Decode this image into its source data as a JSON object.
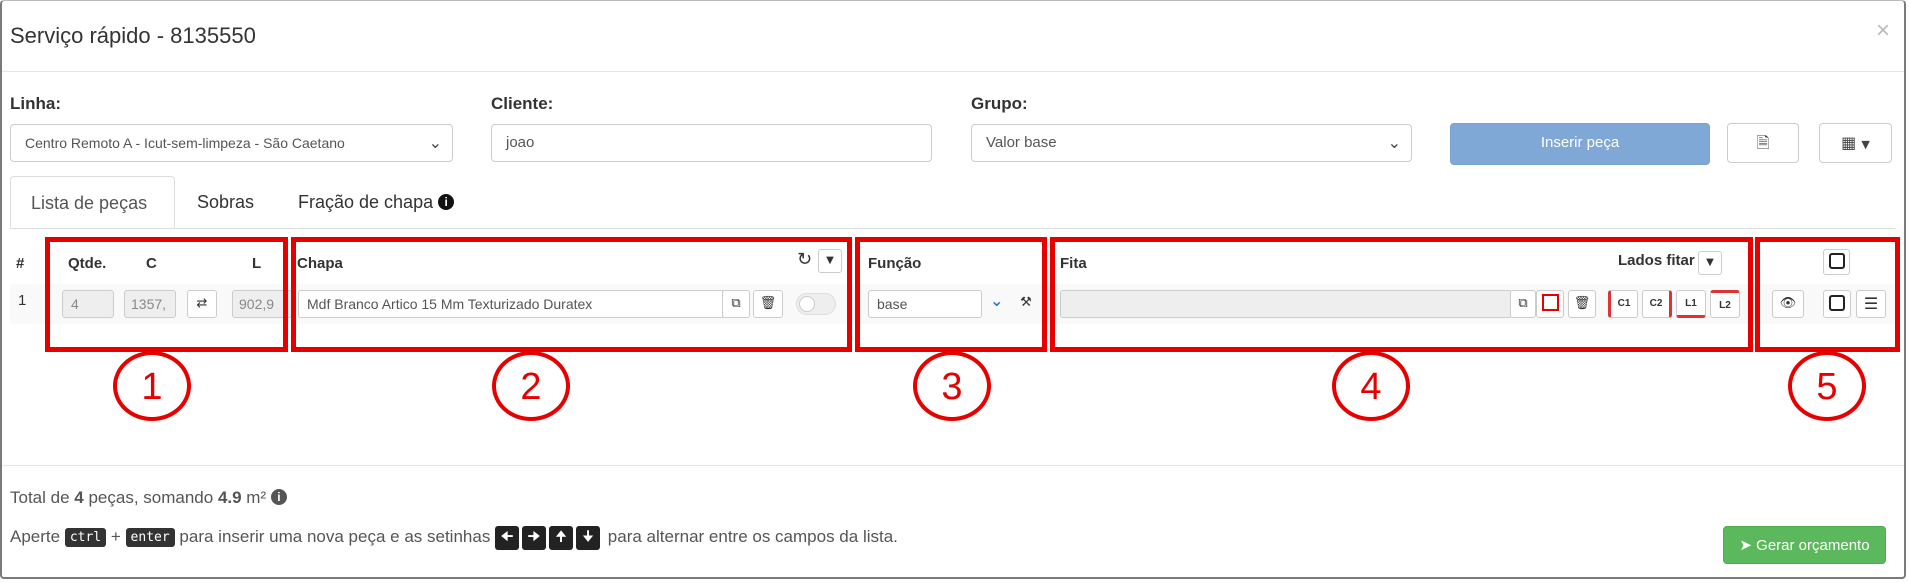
{
  "modal": {
    "title": "Serviço rápido - 8135550",
    "close": "×"
  },
  "fields": {
    "linha_label": "Linha:",
    "linha_value": "Centro Remoto A - Icut-sem-limpeza - São Caetano",
    "cliente_label": "Cliente:",
    "cliente_value": "joao",
    "grupo_label": "Grupo:",
    "grupo_value": "Valor base"
  },
  "toolbar": {
    "insert_label": "Inserir peça"
  },
  "tabs": [
    {
      "label": "Lista de peças"
    },
    {
      "label": "Sobras"
    },
    {
      "label": "Fração de chapa"
    }
  ],
  "table": {
    "headers": {
      "num": "#",
      "qtde": "Qtde.",
      "c": "C",
      "l": "L",
      "chapa": "Chapa",
      "funcao": "Função",
      "fita": "Fita",
      "lados_fitar": "Lados fitar"
    },
    "row": {
      "num": "1",
      "qtde": "4",
      "c": "1357,",
      "l": "902,9",
      "chapa": "Mdf Branco Artico 15 Mm Texturizado Duratex",
      "funcao": "base",
      "fita": "",
      "edges": [
        "C1",
        "C2",
        "L1",
        "L2"
      ]
    }
  },
  "annotations": [
    "1",
    "2",
    "3",
    "4",
    "5"
  ],
  "footer": {
    "summary_prefix": "Total de ",
    "summary_count": "4",
    "summary_mid": " peças, somando ",
    "summary_area": "4.9",
    "summary_unit": " m²",
    "hint_press": "Aperte",
    "key_ctrl": "ctrl",
    "plus": "+",
    "key_enter": "enter",
    "hint_insert": "para inserir uma nova peça e as setinhas",
    "hint_toggle": "para alternar entre os campos da lista.",
    "generate_label": "Gerar orçamento"
  },
  "colors": {
    "primary": "#7fa8d6",
    "success": "#5cb85c",
    "annotation_red": "#e60000"
  }
}
